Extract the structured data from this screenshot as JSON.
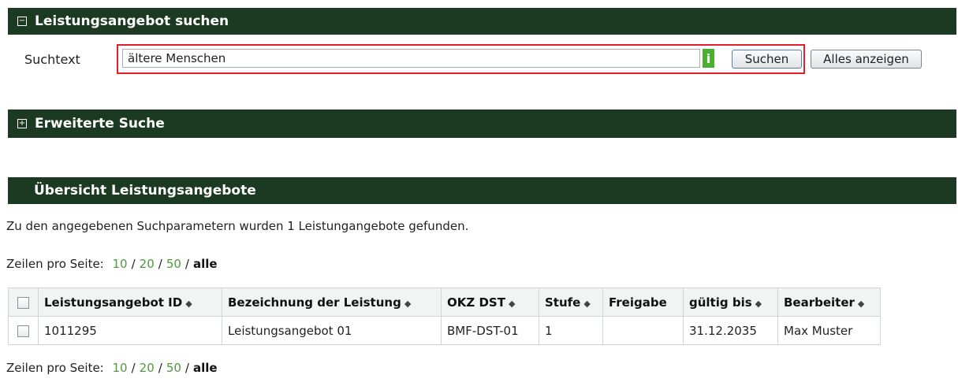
{
  "search_section": {
    "title": "Leistungsangebot suchen",
    "label": "Suchtext",
    "input_value": "ältere Menschen",
    "search_button": "Suchen",
    "show_all_button": "Alles anzeigen"
  },
  "advanced_section": {
    "title": "Erweiterte Suche"
  },
  "overview_section": {
    "title": "Übersicht Leistungsangebote",
    "info": "Zu den angegebenen Suchparametern wurden 1 Leistungangebote gefunden.",
    "rows_label": "Zeilen pro Seite:",
    "rows_options": [
      "10",
      "20",
      "50",
      "alle"
    ]
  },
  "table": {
    "headers": [
      "Leistungsangebot ID",
      "Bezeichnung der Leistung",
      "OKZ DST",
      "Stufe",
      "Freigabe",
      "gültig bis",
      "Bearbeiter"
    ],
    "rows": [
      [
        "1011295",
        "Leistungsangebot 01",
        "BMF-DST-01",
        "1",
        "",
        "31.12.2035",
        "Max Muster"
      ]
    ]
  },
  "colors": {
    "bar_bg": "#1c3a22",
    "link": "#4f9a3e",
    "highlight": "#e32027"
  }
}
